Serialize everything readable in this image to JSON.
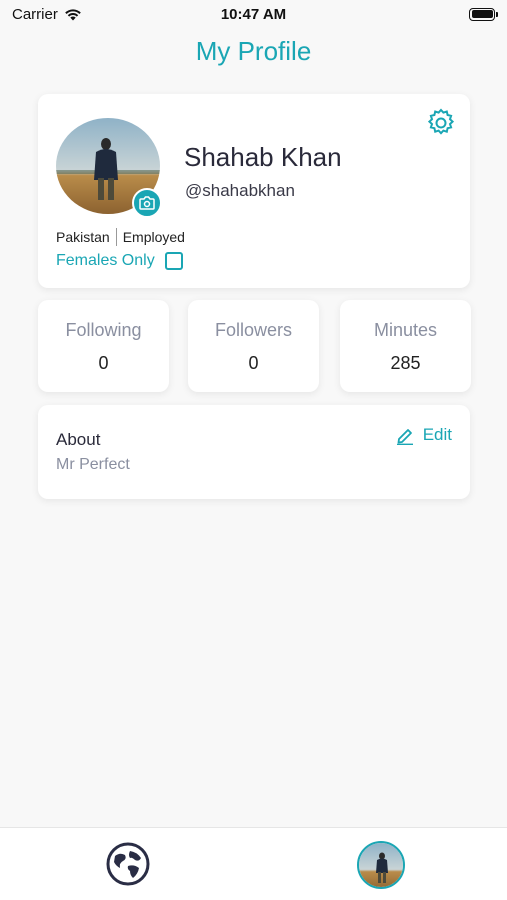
{
  "status_bar": {
    "carrier": "Carrier",
    "time": "10:47 AM"
  },
  "header": {
    "title": "My Profile"
  },
  "profile": {
    "name": "Shahab Khan",
    "handle": "@shahabkhan",
    "country": "Pakistan",
    "employment": "Employed",
    "females_only_label": "Females Only",
    "females_only_checked": false
  },
  "stats": [
    {
      "label": "Following",
      "value": "0"
    },
    {
      "label": "Followers",
      "value": "0"
    },
    {
      "label": "Minutes",
      "value": "285"
    }
  ],
  "about": {
    "title": "About",
    "text": "Mr Perfect",
    "edit_label": "Edit"
  },
  "icons": {
    "gear": "gear-icon",
    "camera": "camera-icon",
    "edit": "pencil-icon",
    "globe": "globe-icon"
  },
  "colors": {
    "accent": "#1aa6b4",
    "text": "#2a2a3a",
    "muted": "#8a8fa0"
  }
}
